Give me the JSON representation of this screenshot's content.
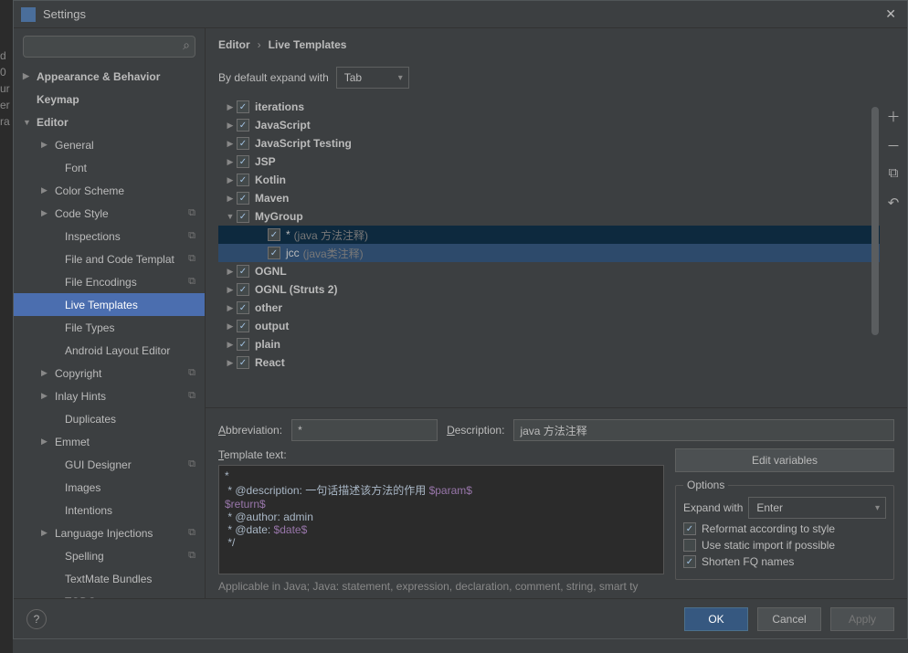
{
  "window": {
    "title": "Settings"
  },
  "leftstrip": [
    "d",
    "0",
    "ur",
    "er",
    "ra"
  ],
  "search": {
    "placeholder": ""
  },
  "nav": [
    {
      "label": "Appearance & Behavior",
      "lvl": 1,
      "arrow": "▶",
      "bold": true
    },
    {
      "label": "Keymap",
      "lvl": 1,
      "bold": true
    },
    {
      "label": "Editor",
      "lvl": 1,
      "arrow": "▼",
      "bold": true
    },
    {
      "label": "General",
      "lvl": 2,
      "arrow": "▶"
    },
    {
      "label": "Font",
      "lvl": 3
    },
    {
      "label": "Color Scheme",
      "lvl": 2,
      "arrow": "▶"
    },
    {
      "label": "Code Style",
      "lvl": 2,
      "arrow": "▶",
      "badge": "⧉"
    },
    {
      "label": "Inspections",
      "lvl": 3,
      "badge": "⧉"
    },
    {
      "label": "File and Code Templat",
      "lvl": 3,
      "badge": "⧉"
    },
    {
      "label": "File Encodings",
      "lvl": 3,
      "badge": "⧉"
    },
    {
      "label": "Live Templates",
      "lvl": 3,
      "sel": true
    },
    {
      "label": "File Types",
      "lvl": 3
    },
    {
      "label": "Android Layout Editor",
      "lvl": 3
    },
    {
      "label": "Copyright",
      "lvl": 2,
      "arrow": "▶",
      "badge": "⧉"
    },
    {
      "label": "Inlay Hints",
      "lvl": 2,
      "arrow": "▶",
      "badge": "⧉"
    },
    {
      "label": "Duplicates",
      "lvl": 3
    },
    {
      "label": "Emmet",
      "lvl": 2,
      "arrow": "▶"
    },
    {
      "label": "GUI Designer",
      "lvl": 3,
      "badge": "⧉"
    },
    {
      "label": "Images",
      "lvl": 3
    },
    {
      "label": "Intentions",
      "lvl": 3
    },
    {
      "label": "Language Injections",
      "lvl": 2,
      "arrow": "▶",
      "badge": "⧉"
    },
    {
      "label": "Spelling",
      "lvl": 3,
      "badge": "⧉"
    },
    {
      "label": "TextMate Bundles",
      "lvl": 3
    },
    {
      "label": "TODO",
      "lvl": 3
    }
  ],
  "breadcrumb": {
    "a": "Editor",
    "b": "Live Templates"
  },
  "expand": {
    "label": "By default expand with",
    "value": "Tab"
  },
  "tree": [
    {
      "label": "iterations",
      "arrow": "▶",
      "checked": true
    },
    {
      "label": "JavaScript",
      "arrow": "▶",
      "checked": true
    },
    {
      "label": "JavaScript Testing",
      "arrow": "▶",
      "checked": true
    },
    {
      "label": "JSP",
      "arrow": "▶",
      "checked": true
    },
    {
      "label": "Kotlin",
      "arrow": "▶",
      "checked": true
    },
    {
      "label": "Maven",
      "arrow": "▶",
      "checked": true
    },
    {
      "label": "MyGroup",
      "arrow": "▼",
      "checked": true
    },
    {
      "label": "*",
      "hint": "(java 方法注释)",
      "child": true,
      "checked": true,
      "sel": true
    },
    {
      "label": "jcc",
      "hint": "(java类注释)",
      "child": true,
      "checked": true,
      "sel2": true
    },
    {
      "label": "OGNL",
      "arrow": "▶",
      "checked": true
    },
    {
      "label": "OGNL (Struts 2)",
      "arrow": "▶",
      "checked": true
    },
    {
      "label": "other",
      "arrow": "▶",
      "checked": true
    },
    {
      "label": "output",
      "arrow": "▶",
      "checked": true
    },
    {
      "label": "plain",
      "arrow": "▶",
      "checked": true
    },
    {
      "label": "React",
      "arrow": "▶",
      "checked": true
    }
  ],
  "form": {
    "abbr_label": "Abbreviation:",
    "abbr_value": "*",
    "desc_label": "Description:",
    "desc_value": "java 方法注释",
    "template_label": "Template text:",
    "edit_vars": "Edit variables",
    "options_label": "Options",
    "expand_with_label": "Expand with",
    "expand_with_value": "Enter",
    "opt1": "Reformat according to style",
    "opt2": "Use static import if possible",
    "opt3": "Shorten FQ names",
    "applicable": "Applicable in Java; Java: statement, expression, declaration, comment, string, smart ty"
  },
  "template_lines": {
    "l1": "*",
    "l2a": " * @description: 一句话描述该方法的作用 ",
    "l2b": "$param$",
    "l3": "$return$",
    "l4": " * @author: admin",
    "l5a": " * @date: ",
    "l5b": "$date$",
    "l6": " */"
  },
  "footer": {
    "ok": "OK",
    "cancel": "Cancel",
    "apply": "Apply"
  }
}
